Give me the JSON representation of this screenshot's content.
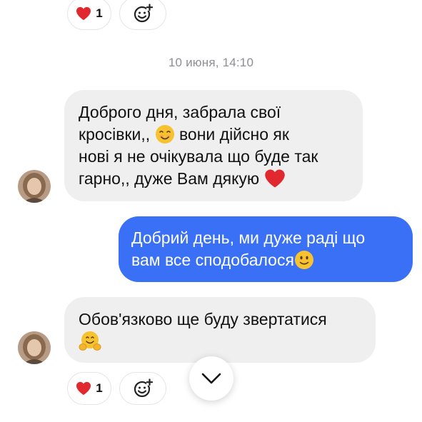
{
  "top_reactions": {
    "heart_count": "1"
  },
  "timestamp": "10 июня, 14:10",
  "messages": [
    {
      "direction": "incoming",
      "lines": [
        "Доброго дня, забрала свої",
        "кросівки,, ",
        " вони дійсно як",
        "нові я не очікувала що буде так",
        "гарно,, дуже Вам дякую "
      ]
    },
    {
      "direction": "outgoing",
      "lines": [
        "Добрий день, ми дуже раді що",
        "вам все сподобалося"
      ]
    },
    {
      "direction": "incoming",
      "lines": [
        "Обов'язково ще буду звертатися"
      ]
    }
  ],
  "bottom_reactions": {
    "heart_count": "1"
  },
  "colors": {
    "incoming_bubble": "#efefef",
    "outgoing_bubble": "#3a70f5",
    "heart": "#e0282e",
    "timestamp_text": "#8e8e93"
  },
  "icons": [
    "heart-icon",
    "add-reaction-icon",
    "smiling-face-icon",
    "slightly-smiling-face-icon",
    "hugging-face-icon",
    "chevron-down-icon"
  ]
}
